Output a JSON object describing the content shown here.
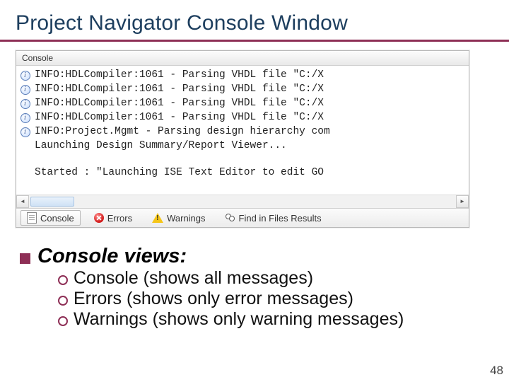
{
  "title": "Project Navigator Console Window",
  "console": {
    "panel_label": "Console",
    "info_lines": [
      "INFO:HDLCompiler:1061 - Parsing VHDL file \"C:/X",
      "INFO:HDLCompiler:1061 - Parsing VHDL file \"C:/X",
      "INFO:HDLCompiler:1061 - Parsing VHDL file \"C:/X",
      "INFO:HDLCompiler:1061 - Parsing VHDL file \"C:/X",
      "INFO:Project.Mgmt - Parsing design hierarchy com"
    ],
    "plain_lines": [
      "Launching Design Summary/Report Viewer...",
      "",
      "Started : \"Launching ISE Text Editor to edit GO"
    ],
    "tabs": {
      "console": "Console",
      "errors": "Errors",
      "warnings": "Warnings",
      "find": "Find in Files Results"
    }
  },
  "bullets": {
    "heading": "Console views:",
    "items": [
      "Console (shows all messages)",
      "Errors (shows only error messages)",
      "Warnings (shows only warning messages)"
    ]
  },
  "page_number": "48"
}
